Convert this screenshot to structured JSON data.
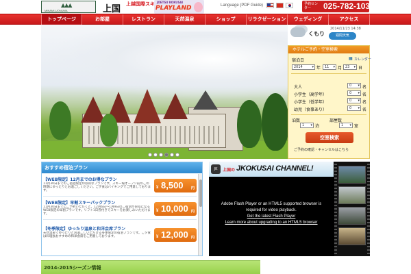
{
  "header": {
    "logo_text": "MINAMI-UONUMA",
    "ski_name": "上国",
    "ski_sub": "上越国際スキー場",
    "playland_top": "JOETSU KOKUSAI",
    "playland_name": "PLAYLAND",
    "language_label": "Language (PDF Guide)",
    "tel_label": "予約センター",
    "tel_number": "025-782-1030"
  },
  "nav": {
    "items": [
      {
        "label": "トップページ",
        "active": true
      },
      {
        "label": "お部屋"
      },
      {
        "label": "レストラン"
      },
      {
        "label": "天然温泉"
      },
      {
        "label": "ショップ"
      },
      {
        "label": "リラクゼーション"
      },
      {
        "label": "ウェディング"
      },
      {
        "label": "アクセス"
      }
    ]
  },
  "hero": {
    "slide_count": 6,
    "active_slide": 4
  },
  "weather": {
    "condition": "くもり",
    "datetime": "2014/11/23 14:38",
    "button": "週間天気"
  },
  "booking": {
    "title": "ホテルご予約・空室検索",
    "checkin_label": "宿泊日",
    "calendar_link": "カレンダー",
    "year": "2014",
    "month": "11",
    "day": "23",
    "rows": [
      {
        "label": "大人",
        "value": "0"
      },
      {
        "label": "小学生（高学年）",
        "value": "0"
      },
      {
        "label": "小学生（低学年）",
        "value": "0"
      },
      {
        "label": "幼児（食事あり）",
        "value": "0"
      }
    ],
    "nights_label": "泊数",
    "nights_value": "1",
    "rooms_label": "部屋数",
    "rooms_value": "1",
    "search_button": "空室検索",
    "note": "ご予約の確認・キャンセルはこちら"
  },
  "promo": {
    "title": "おすすめ宿泊プラン",
    "items": [
      {
        "title": "【WEB限定】12月までのお得なプラン",
        "desc": "11月30日までのご宿泊限定のお得なプランです。スキー場オープン前のこの時期にゆったりとお過ごしください。ご夕食はバイキングでご用意しております。",
        "price": "8,500"
      },
      {
        "title": "【WEB限定】早割スキーパックプラン",
        "desc": "11月30日までにご予約いただくと、12月6日〜1月9日のご宿泊がお得になるWEB限定の早割プランです。リフト1日券付きでスキーをお楽しみいただけます。",
        "price": "10,000"
      },
      {
        "title": "【冬季限定】ゆったり温泉と和洋会席プラン",
        "desc": "天然温泉でゆったりとお過ごしいただける冬季限定の宿泊プランです。ご夕食は料理長おすすめの和洋会席をご用意しております。",
        "price": "12,000"
      }
    ],
    "yen": "¥",
    "unit": "円"
  },
  "channel": {
    "badge": "JK",
    "prefix": "上国の",
    "title": "JKOKUSAI CHANNEL!",
    "msg1": "Adobe Flash Player or an HTML5 supported browser is",
    "msg2": "required for video playback.",
    "link1": "Get the latest Flash Player",
    "link2": "Learn more about upgrading to an HTML5 browser"
  },
  "season": {
    "title": "2014-2015シーズン情報"
  }
}
